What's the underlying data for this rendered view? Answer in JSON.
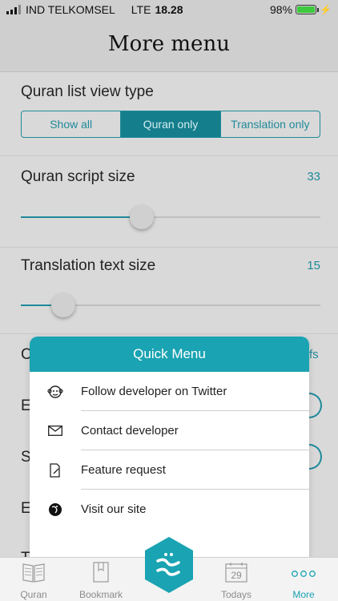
{
  "status_bar": {
    "carrier": "IND TELKOMSEL",
    "network": "LTE",
    "time": "18.28",
    "battery": "98%",
    "battery_level": 0.98
  },
  "header": {
    "title": "More menu"
  },
  "settings": {
    "list_view": {
      "title": "Quran list view type",
      "options": [
        "Show all",
        "Quran only",
        "Translation only"
      ],
      "selected": "Quran only"
    },
    "script_size": {
      "title": "Quran script size",
      "value": "33",
      "fraction": 0.395
    },
    "translation_size": {
      "title": "Translation text size",
      "value": "15",
      "fraction": 0.11
    },
    "peek_rows": {
      "row1_initial": "C",
      "row1_right": "fs",
      "row2_initial": "E",
      "row3_initial": "S",
      "row4_initial": "E",
      "row5_initial": "T"
    }
  },
  "quick_menu": {
    "title": "Quick Menu",
    "items": [
      {
        "label": "Follow developer on Twitter",
        "icon": "monkey-icon"
      },
      {
        "label": "Contact developer",
        "icon": "envelope-icon"
      },
      {
        "label": "Feature request",
        "icon": "edit-document-icon"
      },
      {
        "label": "Visit our site",
        "icon": "globe-icon"
      }
    ]
  },
  "tab_bar": {
    "tabs": [
      {
        "label": "Quran",
        "icon": "book-open-icon"
      },
      {
        "label": "Bookmark",
        "icon": "bookmark-book-icon"
      },
      {
        "label": "",
        "icon": "app-logo-icon"
      },
      {
        "label": "Todays",
        "icon": "calendar-icon",
        "date": "29"
      },
      {
        "label": "More",
        "icon": "more-dots-icon"
      }
    ],
    "active": "More"
  },
  "colors": {
    "accent": "#1aa3b2",
    "accent_dark": "#157e8c",
    "battery_green": "#3ec93e"
  }
}
